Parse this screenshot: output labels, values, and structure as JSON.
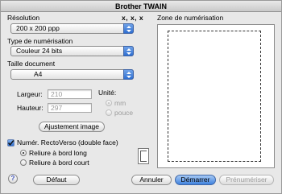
{
  "window": {
    "title": "Brother TWAIN"
  },
  "resolution": {
    "label": "Résolution",
    "xxx_label": "x, x, x",
    "value": "200 x 200 ppp"
  },
  "scan_type": {
    "label": "Type de numérisation",
    "value": "Couleur 24 bits"
  },
  "doc_size": {
    "label": "Taille document",
    "value": "A4"
  },
  "dimensions": {
    "width_label": "Largeur:",
    "width_value": "210",
    "height_label": "Hauteur:",
    "height_value": "297",
    "unit_label": "Unité:",
    "unit_mm": "mm",
    "unit_inch": "pouce"
  },
  "adjust_button": "Ajustement image",
  "duplex": {
    "label": "Numér. RectoVerso (double face)",
    "long_edge": "Reliure à bord long",
    "short_edge": "Reliure à bord court"
  },
  "scan_area": {
    "label": "Zone de numérisation"
  },
  "buttons": {
    "help": "?",
    "default": "Défaut",
    "cancel": "Annuler",
    "start": "Démarrer",
    "prescan": "Prénumériser"
  }
}
